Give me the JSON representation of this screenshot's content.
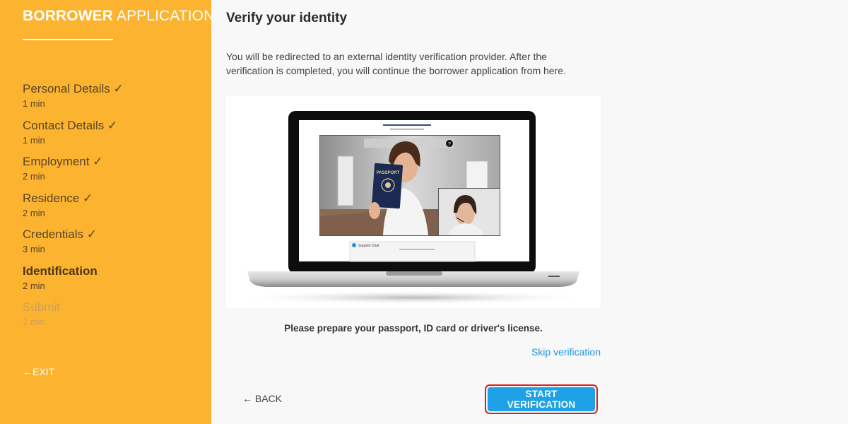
{
  "sidebar": {
    "brand_bold": "BORROWER",
    "brand_light": "APPLICATION",
    "steps": [
      {
        "label": "Personal Details ✓",
        "time": "1 min"
      },
      {
        "label": "Contact Details ✓",
        "time": "1 min"
      },
      {
        "label": "Employment ✓",
        "time": "2 min"
      },
      {
        "label": "Residence ✓",
        "time": "2 min"
      },
      {
        "label": "Credentials ✓",
        "time": "3 min"
      },
      {
        "label": "Identification",
        "time": "2 min"
      },
      {
        "label": "Submit",
        "time": "1 min"
      }
    ],
    "exit_label": "←EXIT"
  },
  "main": {
    "title": "Verify your identity",
    "description": "You will be redirected to an external identity verification provider. After the verification is completed, you will continue the borrower application from here.",
    "illustration": {
      "passport_text": "PASSPORT",
      "support_chat": "Support Chat"
    },
    "instruction": "Please prepare your passport, ID card or driver's license.",
    "skip_label": "Skip verification",
    "back_label": "← BACK",
    "start_label": "START VERIFICATION"
  },
  "colors": {
    "sidebar_bg": "#fbb330",
    "accent_blue": "#1ea1e6",
    "link_blue": "#2196d8",
    "highlight_red": "#d92020"
  }
}
